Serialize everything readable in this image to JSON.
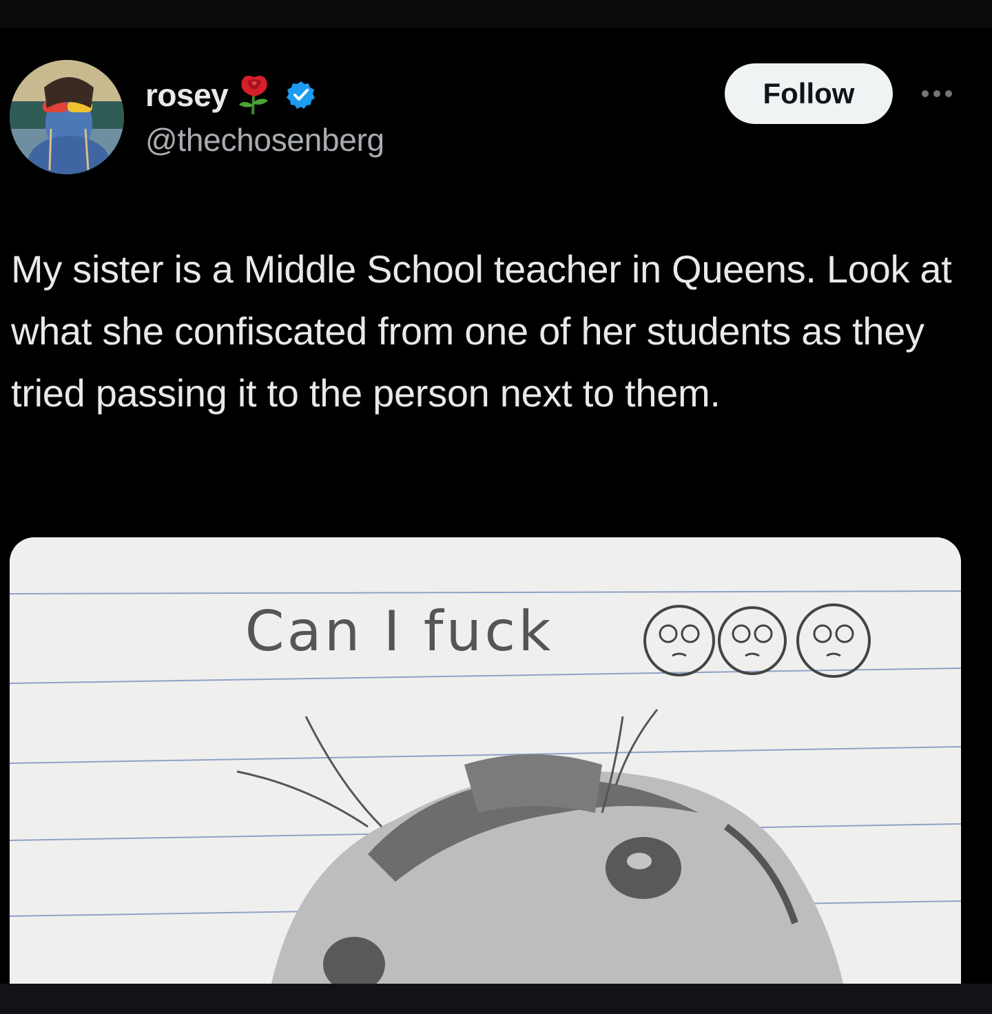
{
  "post": {
    "author": {
      "display_name": "rosey",
      "handle": "@thechosenberg",
      "verified": true,
      "name_emoji_icon": "rose-icon"
    },
    "follow_label": "Follow",
    "more_icon": "more-horizontal-icon",
    "text": "My sister is a Middle School teacher in Queens. Look at what she confiscated from one of her students as they tried passing it to the person next to them.",
    "media": {
      "handwritten_text": "Can I fuck",
      "drawn_icons": [
        "pleading-face-icon",
        "pleading-face-icon",
        "pleading-face-icon"
      ]
    }
  },
  "colors": {
    "background": "#000000",
    "text_primary": "#e7e9ea",
    "text_secondary": "#a9adb2",
    "verified_blue": "#1d9bf0",
    "follow_button_bg": "#eff3f4"
  }
}
